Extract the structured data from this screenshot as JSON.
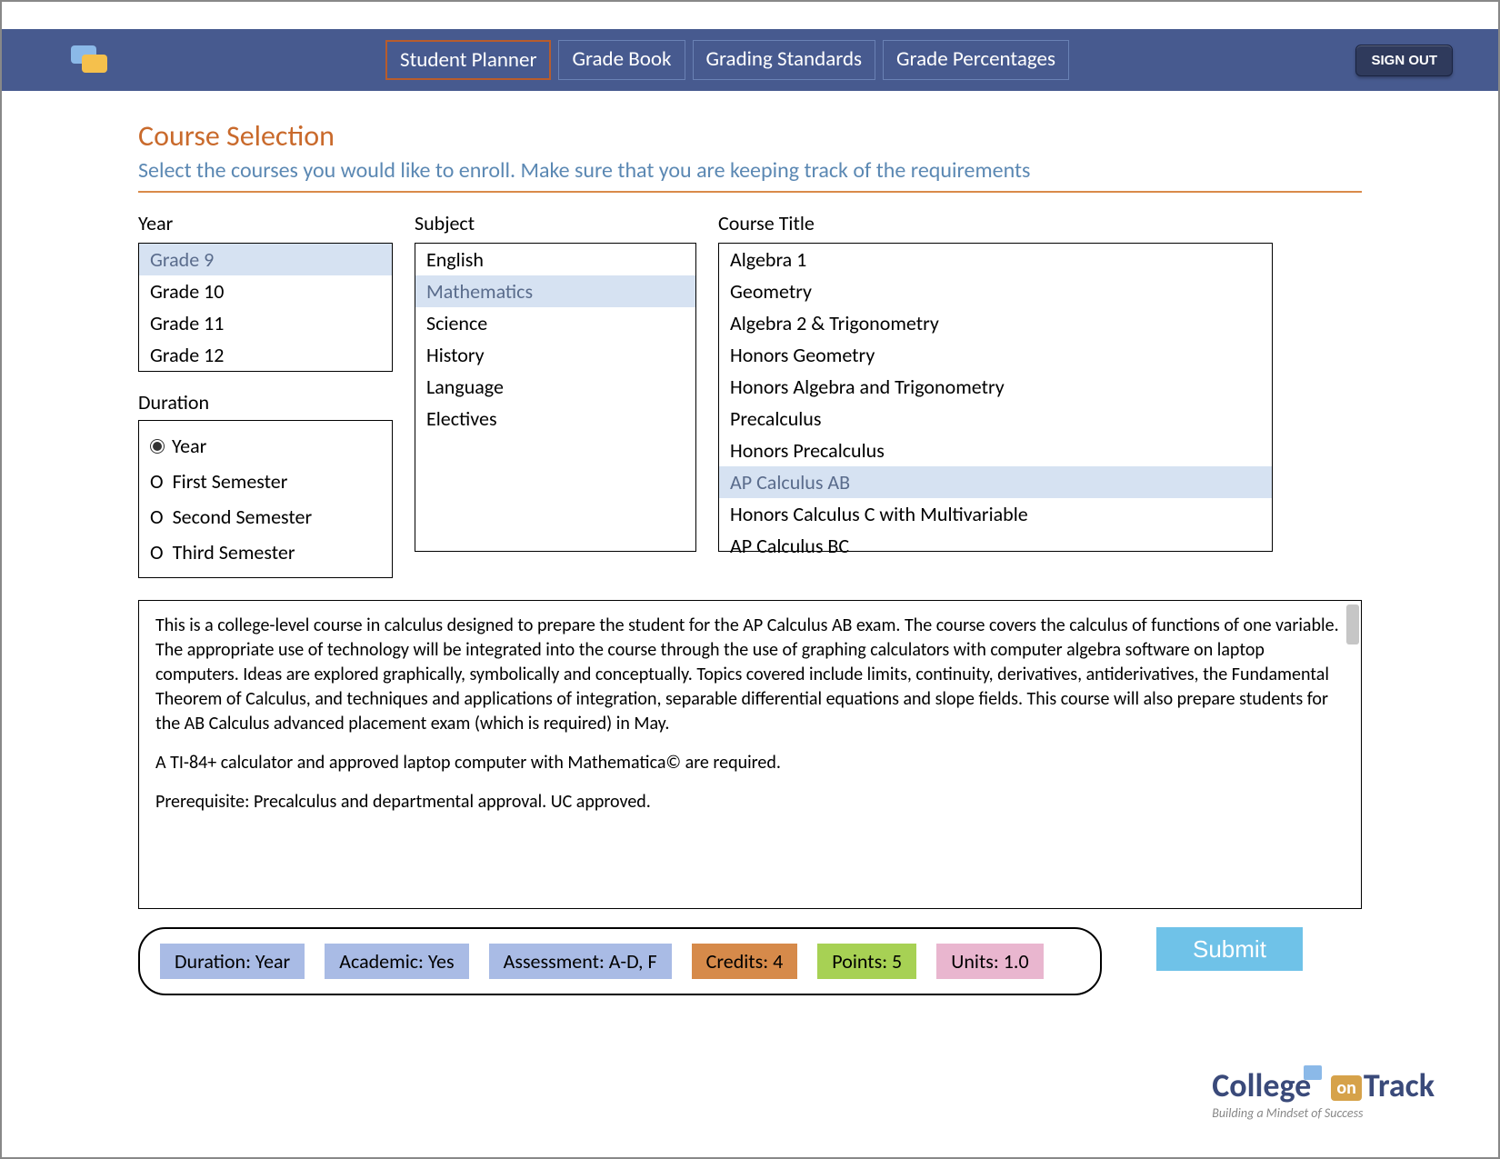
{
  "nav": {
    "items": [
      "Student Planner",
      "Grade Book",
      "Grading Standards",
      "Grade  Percentages"
    ],
    "active": 0,
    "signout": "SIGN OUT"
  },
  "page": {
    "title": "Course Selection",
    "subtitle": "Select the courses you would like to enroll. Make sure that you are keeping track of the requirements"
  },
  "year": {
    "label": "Year",
    "items": [
      "Grade 9",
      "Grade 10",
      "Grade 11",
      "Grade 12"
    ],
    "selected": 0
  },
  "duration": {
    "label": "Duration",
    "options": [
      "Year",
      "First Semester",
      "Second Semester",
      "Third Semester"
    ],
    "selected": 0
  },
  "subject": {
    "label": "Subject",
    "items": [
      "English",
      "Mathematics",
      "Science",
      "History",
      "Language",
      "Electives"
    ],
    "selected": 1
  },
  "course": {
    "label": "Course Title",
    "items": [
      "Algebra 1",
      "Geometry",
      "Algebra 2 & Trigonometry",
      "Honors Geometry",
      "Honors Algebra and Trigonometry",
      "Precalculus",
      "Honors Precalculus",
      "AP Calculus AB",
      "Honors Calculus C with Multivariable",
      "AP Calculus BC"
    ],
    "selected": 7
  },
  "description": {
    "p1": "This is a college-level course in calculus designed to prepare the student for the AP Calculus AB exam. The course covers the calculus of functions of one variable. The appropriate use of technology will be integrated into the course through the use of graphing calculators with computer algebra software on laptop computers. Ideas are explored graphically, symbolically and conceptually. Topics covered include limits, continuity, derivatives, antiderivatives, the Fundamental Theorem of Calculus, and techniques and applications of integration, separable differential equations and slope fields. This course will also prepare students for the AB Calculus advanced placement exam (which is required) in May.",
    "p2": "A TI-84+ calculator and approved laptop computer with Mathematica© are required.",
    "p3": "Prerequisite: Precalculus and departmental approval. UC approved."
  },
  "summary": {
    "duration": "Duration:  Year",
    "academic": "Academic:  Yes",
    "assessment": "Assessment:  A-D, F",
    "credits": "Credits: 4",
    "points": "Points: 5",
    "units": "Units: 1.0"
  },
  "submit": "Submit",
  "logo": {
    "part1": "College",
    "on": "on",
    "part2": "Track",
    "tag": "Building a Mindset of Success"
  }
}
